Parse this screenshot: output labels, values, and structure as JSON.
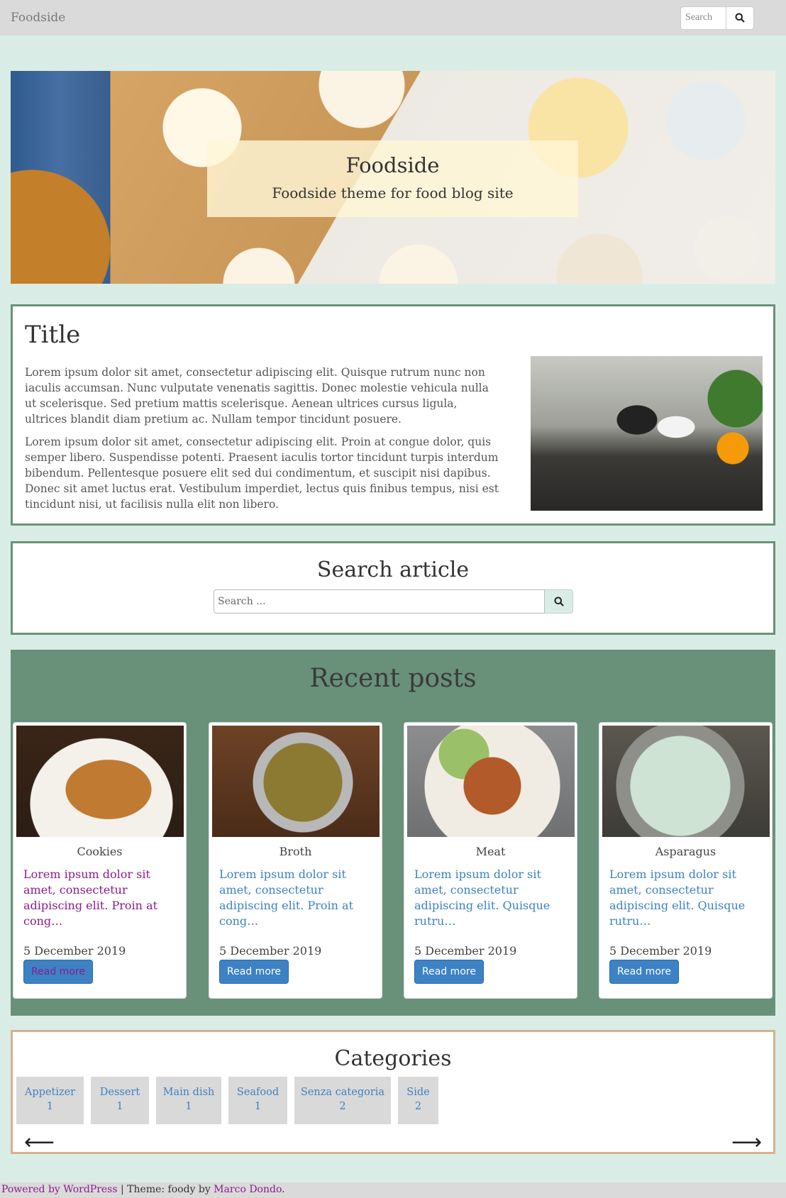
{
  "navbar": {
    "brand": "Foodside",
    "search_placeholder": "Search"
  },
  "hero": {
    "title": "Foodside",
    "tagline": "Foodside theme for food blog site"
  },
  "about": {
    "title": "Title",
    "paragraphs": [
      "Lorem ipsum dolor sit amet, consectetur adipiscing elit. Quisque rutrum nunc non iaculis accumsan. Nunc vulputate venenatis sagittis. Donec molestie vehicula nulla ut scelerisque. Sed pretium mattis scelerisque. Aenean ultrices cursus ligula, ultrices blandit diam pretium ac. Nullam tempor tincidunt posuere.",
      "Lorem ipsum dolor sit amet, consectetur adipiscing elit. Proin at congue dolor, quis semper libero. Suspendisse potenti. Praesent iaculis tortor tincidunt turpis interdum bibendum. Pellentesque posuere elit sed dui condimentum, et suscipit nisi dapibus. Donec sit amet luctus erat. Vestibulum imperdiet, lectus quis finibus tempus, nisi est tincidunt nisi, ut facilisis nulla elit non libero."
    ]
  },
  "search_article": {
    "title": "Search article",
    "placeholder": "Search ..."
  },
  "recent_posts": {
    "title": "Recent posts",
    "posts": [
      {
        "category": "Cookies",
        "excerpt": "Lorem ipsum dolor sit amet, consectetur adipiscing elit. Proin at cong…",
        "date": "5 December 2019",
        "button": "Read more"
      },
      {
        "category": "Broth",
        "excerpt": "Lorem ipsum dolor sit amet, consectetur adipiscing elit. Proin at cong…",
        "date": "5 December 2019",
        "button": "Read more"
      },
      {
        "category": "Meat",
        "excerpt": "Lorem ipsum dolor sit amet, consectetur adipiscing elit. Quisque rutru…",
        "date": "5 December 2019",
        "button": "Read more"
      },
      {
        "category": "Asparagus",
        "excerpt": "Lorem ipsum dolor sit amet, consectetur adipiscing elit. Quisque rutru…",
        "date": "5 December 2019",
        "button": "Read more"
      }
    ]
  },
  "categories": {
    "title": "Categories",
    "items": [
      {
        "name": "Appetizer",
        "count": "1"
      },
      {
        "name": "Dessert",
        "count": "1"
      },
      {
        "name": "Main dish",
        "count": "1"
      },
      {
        "name": "Seafood",
        "count": "1"
      },
      {
        "name": "Senza categoria",
        "count": "2"
      },
      {
        "name": "Side",
        "count": "2"
      }
    ],
    "prev_icon": "arrow-left-icon",
    "next_icon": "arrow-right-icon"
  },
  "footer": {
    "powered": "Powered by WordPress",
    "separator": " | Theme: foody by ",
    "author": "Marco Dondo",
    "end": "."
  },
  "colors": {
    "page_bg": "#d9ede6",
    "accent_green": "#69917a",
    "link_blue": "#3d82c4",
    "visited_purple": "#8b1c8b",
    "categories_border": "#d8b08e"
  }
}
